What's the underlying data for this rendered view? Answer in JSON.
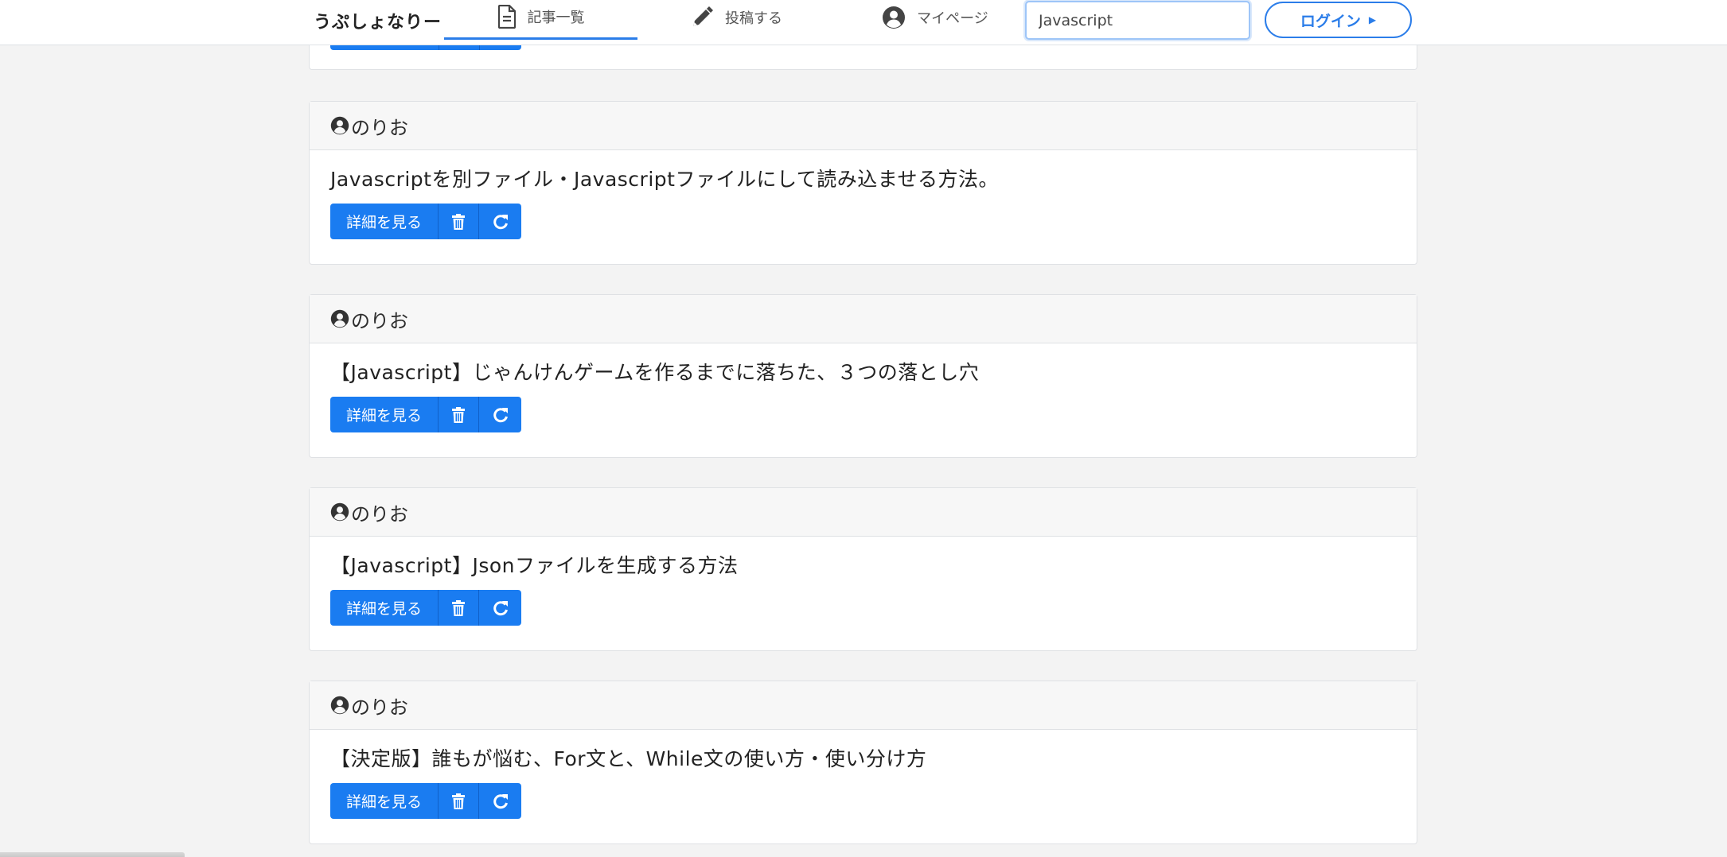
{
  "navbar": {
    "brand": "うぷしょなりー",
    "items": [
      {
        "label": "記事一覧",
        "icon": "document-icon",
        "active": true
      },
      {
        "label": "投稿する",
        "icon": "pencil-icon",
        "active": false
      },
      {
        "label": "マイページ",
        "icon": "user-circle-icon",
        "active": false
      }
    ],
    "search_value": "Javascript",
    "login_label": "ログイン"
  },
  "posts": [
    {
      "author": "のりお",
      "title": "Javascriptを別ファイル・Javascriptファイルにして読み込ませる方法。",
      "detail_label": "詳細を見る"
    },
    {
      "author": "のりお",
      "title": "【Javascript】じゃんけんゲームを作るまでに落ちた、３つの落とし穴",
      "detail_label": "詳細を見る"
    },
    {
      "author": "のりお",
      "title": "【Javascript】Jsonファイルを生成する方法",
      "detail_label": "詳細を見る"
    },
    {
      "author": "のりお",
      "title": "【決定版】誰もが悩む、For文と、While文の使い方・使い分け方",
      "detail_label": "詳細を見る"
    }
  ],
  "colors": {
    "primary": "#1a7cf1",
    "accent": "#2b7de9",
    "background": "#f3f3f3"
  }
}
